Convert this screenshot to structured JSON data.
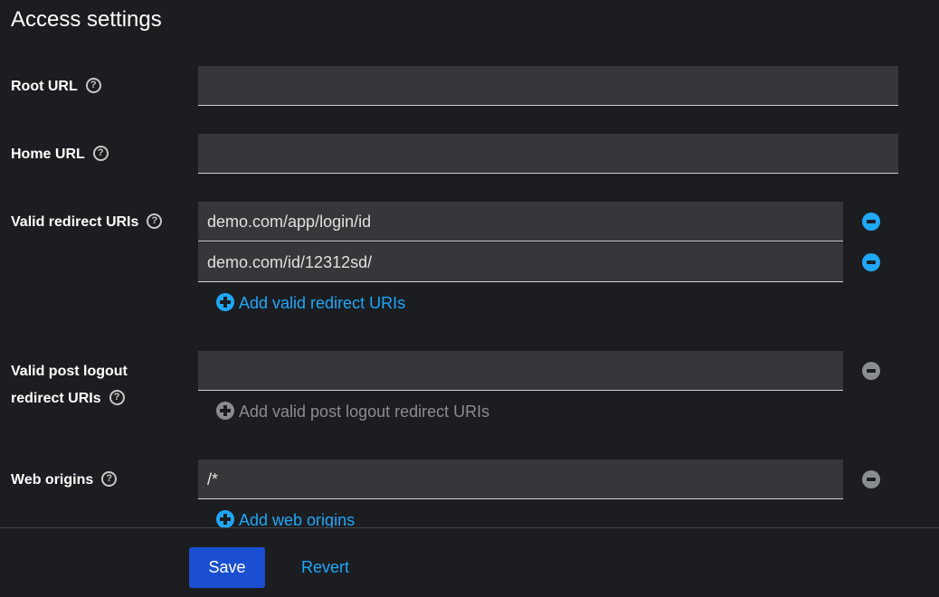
{
  "section_title": "Access settings",
  "fields": {
    "root_url": {
      "label": "Root URL",
      "value": ""
    },
    "home_url": {
      "label": "Home URL",
      "value": ""
    },
    "valid_redirect_uris": {
      "label": "Valid redirect URIs",
      "values": [
        "demo.com/app/login/id",
        "demo.com/id/12312sd/"
      ],
      "add_label": "Add valid redirect URIs"
    },
    "valid_post_logout_redirect_uris": {
      "label_line1": "Valid post logout",
      "label_line2": "redirect URIs",
      "values": [
        ""
      ],
      "add_label": "Add valid post logout redirect URIs"
    },
    "web_origins": {
      "label": "Web origins",
      "values": [
        "/*"
      ],
      "add_label": "Add web origins"
    }
  },
  "help_glyph": "?",
  "footer": {
    "save_label": "Save",
    "revert_label": "Revert"
  },
  "colors": {
    "accent": "#1fa7f8",
    "primary_button": "#1a4fd1",
    "background": "#1b1d21",
    "input_bg": "#36373a"
  }
}
